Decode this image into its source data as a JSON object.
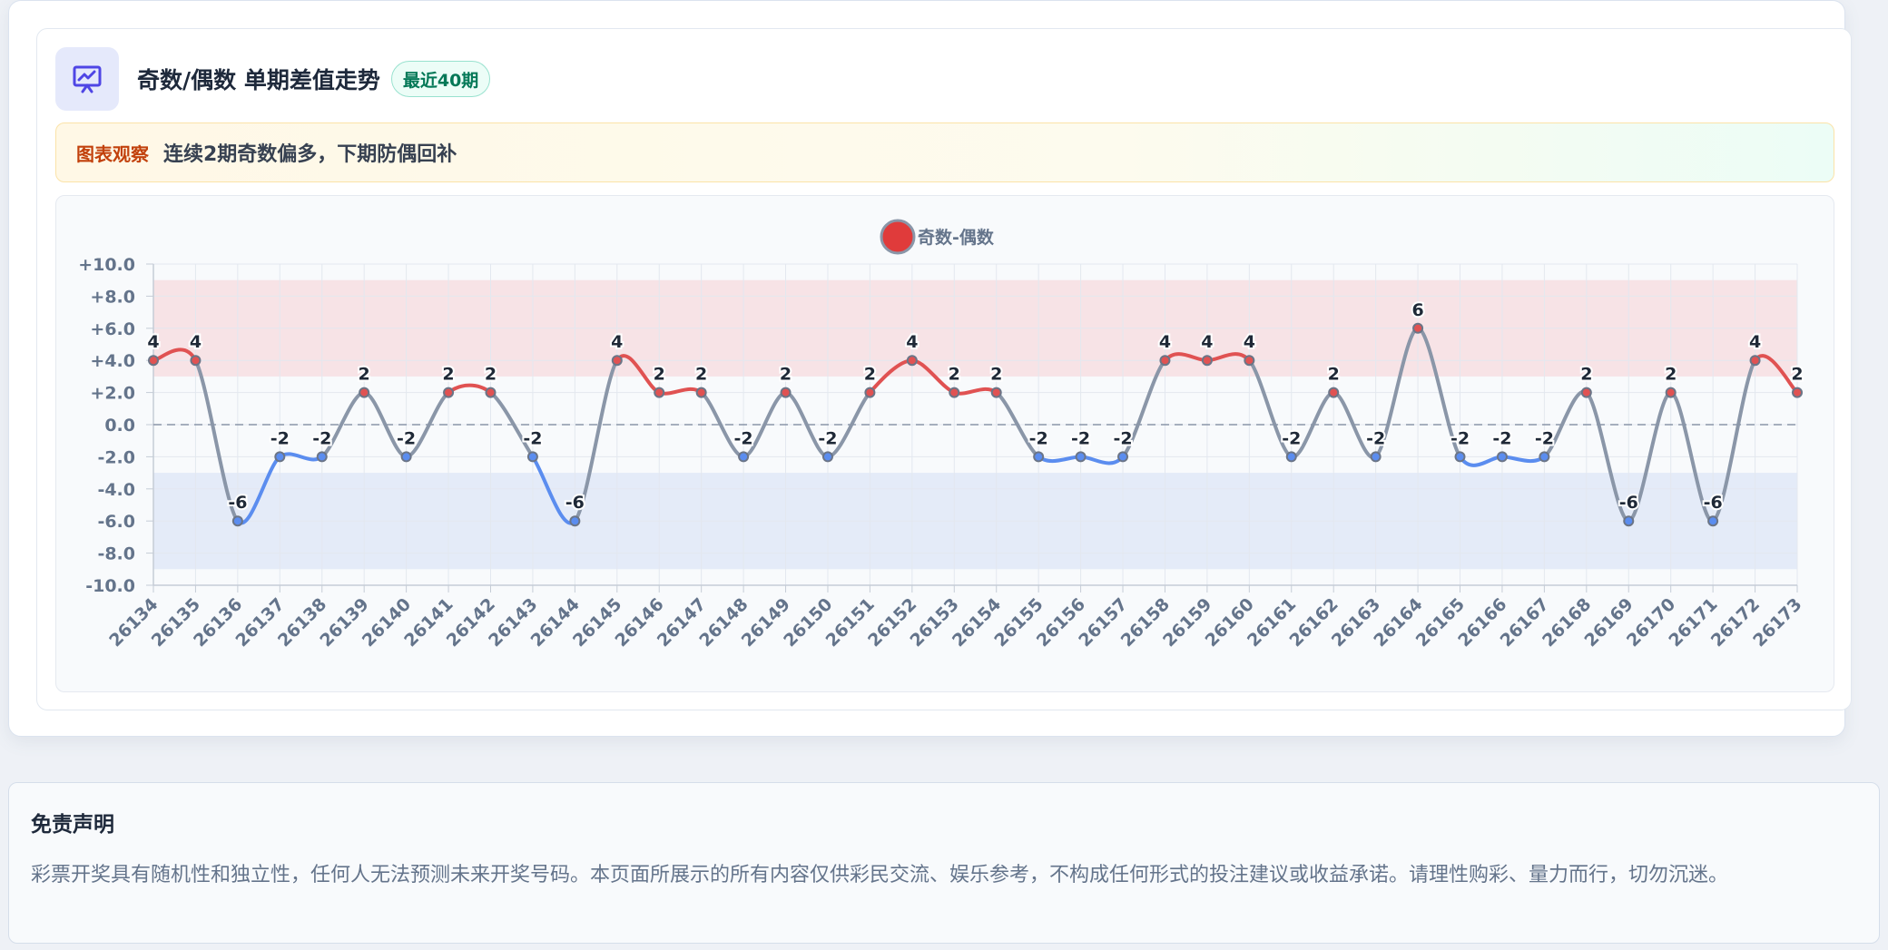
{
  "header": {
    "title": "奇数/偶数 单期差值走势",
    "badge": "最近40期",
    "icon": "presentation-chart-icon"
  },
  "observation": {
    "tag": "图表观察",
    "text": "连续2期奇数偏多，下期防偶回补"
  },
  "disclaimer": {
    "title": "免责声明",
    "text": "彩票开奖具有随机性和独立性，任何人无法预测未来开奖号码。本页面所展示的所有内容仅供彩民交流、娱乐参考，不构成任何形式的投注建议或收益承诺。请理性购彩、量力而行，切勿沉迷。"
  },
  "colors": {
    "positive": "#e05252",
    "negative": "#5b8def",
    "neutral": "#8a96a8",
    "positive_band": "#f7e3e6",
    "negative_band": "#e4ebf8",
    "legend_dot": "#e03b3b"
  },
  "chart_data": {
    "type": "line",
    "title": "",
    "xlabel": "",
    "ylabel": "",
    "legend": {
      "position": "top-center"
    },
    "grid": true,
    "ylim": [
      -10,
      10
    ],
    "y_ticks": [
      10,
      8,
      6,
      4,
      2,
      0,
      -2,
      -4,
      -6,
      -8,
      -10
    ],
    "y_tick_labels": [
      "+10.0",
      "+8.0",
      "+6.0",
      "+4.0",
      "+2.0",
      "0.0",
      "-2.0",
      "-4.0",
      "-6.0",
      "-8.0",
      "-10.0"
    ],
    "reference_line": 0,
    "bands": [
      {
        "from": 3,
        "to": 9,
        "color": "positive_band"
      },
      {
        "from": -9,
        "to": -3,
        "color": "negative_band"
      }
    ],
    "categories": [
      "26134",
      "26135",
      "26136",
      "26137",
      "26138",
      "26139",
      "26140",
      "26141",
      "26142",
      "26143",
      "26144",
      "26145",
      "26146",
      "26147",
      "26148",
      "26149",
      "26150",
      "26151",
      "26152",
      "26153",
      "26154",
      "26155",
      "26156",
      "26157",
      "26158",
      "26159",
      "26160",
      "26161",
      "26162",
      "26163",
      "26164",
      "26165",
      "26166",
      "26167",
      "26168",
      "26169",
      "26170",
      "26171",
      "26172",
      "26173"
    ],
    "series": [
      {
        "name": "奇数-偶数",
        "values": [
          4,
          4,
          -6,
          -2,
          -2,
          2,
          -2,
          2,
          2,
          -2,
          -6,
          4,
          2,
          2,
          -2,
          2,
          -2,
          2,
          4,
          2,
          2,
          -2,
          -2,
          -2,
          4,
          4,
          4,
          -2,
          2,
          -2,
          6,
          -2,
          -2,
          -2,
          2,
          -6,
          2,
          -6,
          4,
          2
        ],
        "data_labels": [
          "4",
          "4",
          "-6",
          "-2",
          "-2",
          "2",
          "-2",
          "2",
          "2",
          "-2",
          "-6",
          "4",
          "2",
          "2",
          "-2",
          "2",
          "-2",
          "2",
          "4",
          "2",
          "2",
          "-2",
          "-2",
          "-2",
          "4",
          "4",
          "4",
          "-2",
          "2",
          "-2",
          "6",
          "-2",
          "-2",
          "-2",
          "2",
          "-6",
          "2",
          "-6",
          "4",
          "2"
        ]
      }
    ]
  }
}
